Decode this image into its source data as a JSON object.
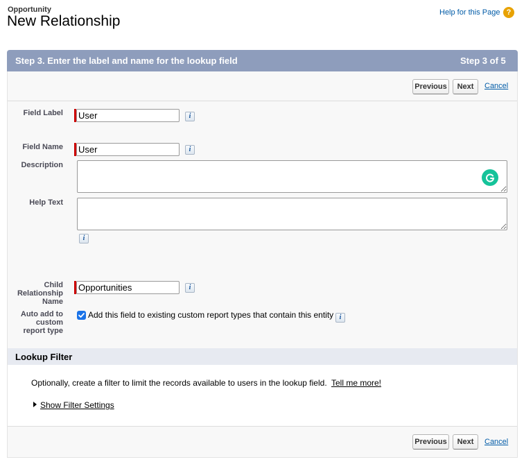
{
  "header": {
    "object_type": "Opportunity",
    "page_title": "New Relationship",
    "help_link": "Help for this Page",
    "help_icon": "?"
  },
  "step": {
    "title": "Step 3. Enter the label and name for the lookup field",
    "count": "Step 3 of 5"
  },
  "buttons": {
    "previous": "Previous",
    "next": "Next",
    "cancel": "Cancel"
  },
  "form": {
    "field_label": {
      "label": "Field Label",
      "value": "User"
    },
    "field_name": {
      "label": "Field Name",
      "value": "User"
    },
    "description": {
      "label": "Description",
      "value": ""
    },
    "help_text": {
      "label": "Help Text",
      "value": ""
    },
    "child_relationship": {
      "label_line1": "Child",
      "label_line2": "Relationship",
      "label_line3": "Name",
      "value": "Opportunities"
    },
    "auto_add": {
      "label_line1": "Auto add to",
      "label_line2": "custom",
      "label_line3": "report type",
      "checkbox_text": "Add this field to existing custom report types that contain this entity",
      "checked": true
    },
    "info_glyph": "i"
  },
  "lookup_filter": {
    "title": "Lookup Filter",
    "description": "Optionally, create a filter to limit the records available to users in the lookup field.",
    "tell_me_more": "Tell me more!",
    "show_filter_settings": "Show Filter Settings"
  },
  "colors": {
    "step_bar": "#8e9dbc",
    "link": "#015ba7",
    "required": "#cc0000",
    "help_icon": "#e8a202",
    "grammarly": "#15c39a"
  }
}
